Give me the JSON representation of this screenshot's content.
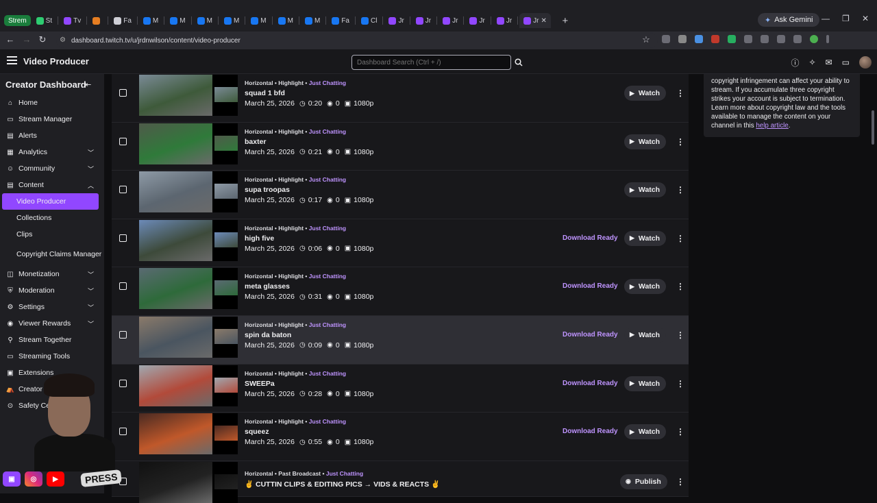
{
  "browser": {
    "tabs": [
      {
        "label": "Strem",
        "color": "#1a7d3c"
      },
      {
        "label": "St",
        "color": "#2ecc71"
      },
      {
        "label": "Tv",
        "color": "#9147ff"
      },
      {
        "label": "",
        "color": "#e67e22"
      },
      {
        "label": "Fa",
        "color": "#cfcfd6"
      },
      {
        "label": "M",
        "color": "#1877f2"
      },
      {
        "label": "M",
        "color": "#1877f2"
      },
      {
        "label": "M",
        "color": "#1877f2"
      },
      {
        "label": "M",
        "color": "#1877f2"
      },
      {
        "label": "M",
        "color": "#1877f2"
      },
      {
        "label": "M",
        "color": "#1877f2"
      },
      {
        "label": "M",
        "color": "#1877f2"
      },
      {
        "label": "Fa",
        "color": "#1877f2"
      },
      {
        "label": "Cl",
        "color": "#1877f2"
      },
      {
        "label": "Jr",
        "color": "#9147ff"
      },
      {
        "label": "Jr",
        "color": "#9147ff"
      },
      {
        "label": "Jr",
        "color": "#9147ff"
      },
      {
        "label": "Jr",
        "color": "#9147ff"
      },
      {
        "label": "Jr",
        "color": "#9147ff"
      },
      {
        "label": "Jr",
        "color": "#9147ff"
      }
    ],
    "new_tab": "+",
    "ask_gemini": "Ask Gemini",
    "url": "dashboard.twitch.tv/u/jrdnwilson/content/video-producer"
  },
  "topnav": {
    "title": "Video Producer",
    "search_placeholder": "Dashboard Search (Ctrl + /)"
  },
  "sidebar": {
    "title": "Creator Dashboard",
    "items": [
      {
        "label": "Home",
        "icon": "home-icon"
      },
      {
        "label": "Stream Manager",
        "icon": "stream-manager-icon"
      },
      {
        "label": "Alerts",
        "icon": "alerts-icon"
      },
      {
        "label": "Analytics",
        "icon": "analytics-icon",
        "chevron": "down"
      },
      {
        "label": "Community",
        "icon": "community-icon",
        "chevron": "down"
      },
      {
        "label": "Content",
        "icon": "content-icon",
        "chevron": "up"
      }
    ],
    "content_sub": [
      "Video Producer",
      "Collections",
      "Clips",
      "Copyright Claims Manager"
    ],
    "items_after": [
      {
        "label": "Monetization",
        "icon": "monetization-icon",
        "chevron": "down"
      },
      {
        "label": "Moderation",
        "icon": "moderation-icon",
        "chevron": "down"
      },
      {
        "label": "Settings",
        "icon": "settings-icon",
        "chevron": "down"
      },
      {
        "label": "Viewer Rewards",
        "icon": "rewards-icon",
        "chevron": "down"
      },
      {
        "label": "Stream Together",
        "icon": "stream-together-icon"
      },
      {
        "label": "Streaming Tools",
        "icon": "streaming-tools-icon"
      },
      {
        "label": "Extensions",
        "icon": "extensions-icon"
      },
      {
        "label": "Creator Camp",
        "icon": "creator-camp-icon"
      },
      {
        "label": "Safety Center",
        "icon": "safety-center-icon"
      }
    ]
  },
  "videos": [
    {
      "tags": "Horizontal • Highlight • ",
      "category": "Just Chatting",
      "title": "squad 1 bfd",
      "date": "March 25, 2026",
      "duration": "0:20",
      "views": "0",
      "quality": "1080p",
      "status": "",
      "action": "Watch"
    },
    {
      "tags": "Horizontal • Highlight • ",
      "category": "Just Chatting",
      "title": "baxter",
      "date": "March 25, 2026",
      "duration": "0:21",
      "views": "0",
      "quality": "1080p",
      "status": "",
      "action": "Watch"
    },
    {
      "tags": "Horizontal • Highlight • ",
      "category": "Just Chatting",
      "title": "supa troopas",
      "date": "March 25, 2026",
      "duration": "0:17",
      "views": "0",
      "quality": "1080p",
      "status": "",
      "action": "Watch"
    },
    {
      "tags": "Horizontal • Highlight • ",
      "category": "Just Chatting",
      "title": "high five",
      "date": "March 25, 2026",
      "duration": "0:06",
      "views": "0",
      "quality": "1080p",
      "status": "Download Ready",
      "action": "Watch"
    },
    {
      "tags": "Horizontal • Highlight • ",
      "category": "Just Chatting",
      "title": "meta glasses",
      "date": "March 25, 2026",
      "duration": "0:31",
      "views": "0",
      "quality": "1080p",
      "status": "Download Ready",
      "action": "Watch"
    },
    {
      "tags": "Horizontal • Highlight • ",
      "category": "Just Chatting",
      "title": "spin da baton",
      "date": "March 25, 2026",
      "duration": "0:09",
      "views": "0",
      "quality": "1080p",
      "status": "Download Ready",
      "action": "Watch"
    },
    {
      "tags": "Horizontal • Highlight • ",
      "category": "Just Chatting",
      "title": "SWEEPa",
      "date": "March 25, 2026",
      "duration": "0:28",
      "views": "0",
      "quality": "1080p",
      "status": "Download Ready",
      "action": "Watch"
    },
    {
      "tags": "Horizontal • Highlight • ",
      "category": "Just Chatting",
      "title": "squeez",
      "date": "March 25, 2026",
      "duration": "0:55",
      "views": "0",
      "quality": "1080p",
      "status": "Download Ready",
      "action": "Watch"
    },
    {
      "tags": "Horizontal • Past Broadcast • ",
      "category": "Just Chatting",
      "title": "✌ CUTTIN CLIPS & EDITING PICS → VIDS & REACTS ✌",
      "date": "",
      "duration": "",
      "views": "",
      "quality": "",
      "status": "",
      "action": "Publish"
    }
  ],
  "info_card": {
    "text": "copyright infringement can affect your ability to stream. If you accumulate three copyright strikes your account is subject to termination. Learn more about copyright law and the tools available to manage the content on your channel in this ",
    "link": "help article",
    "end": "."
  },
  "overlay": {
    "press": "PRESS"
  },
  "colors": {
    "accent": "#9147ff",
    "link": "#bf94ff",
    "background": "#0e0e10"
  }
}
